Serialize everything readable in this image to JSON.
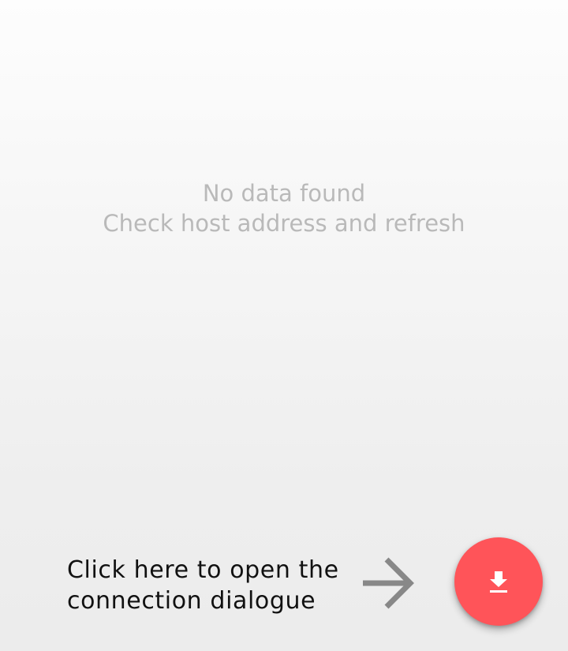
{
  "empty_state": {
    "title": "No data found",
    "message": "Check host address and refresh"
  },
  "hint": {
    "line1": "Click here to open the",
    "line2": "connection dialogue",
    "arrow_icon": "arrow-right-icon"
  },
  "fab": {
    "icon": "download-icon",
    "color": "#ff5459"
  }
}
